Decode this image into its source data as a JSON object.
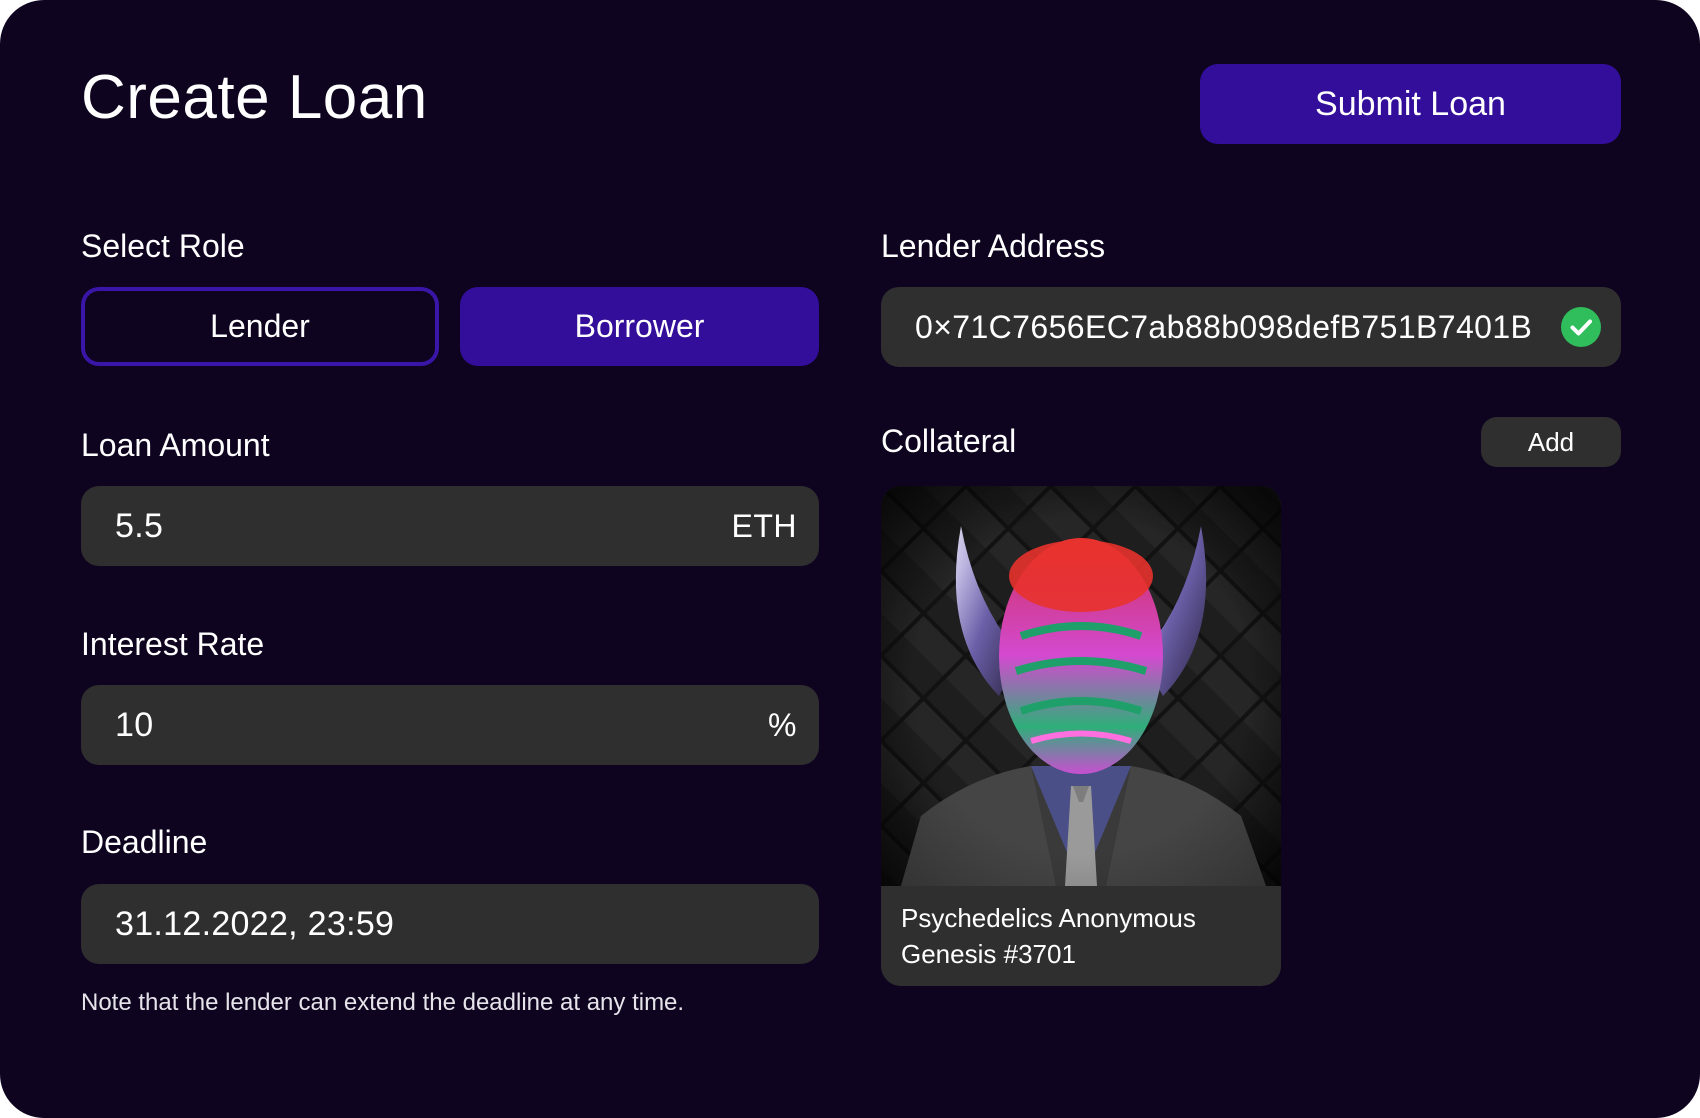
{
  "header": {
    "title": "Create Loan",
    "submit_label": "Submit Loan"
  },
  "role": {
    "label": "Select Role",
    "options": [
      "Lender",
      "Borrower"
    ],
    "selected": "Borrower"
  },
  "loan_amount": {
    "label": "Loan Amount",
    "value": "5.5",
    "unit": "ETH"
  },
  "interest_rate": {
    "label": "Interest Rate",
    "value": "10",
    "unit": "%"
  },
  "deadline": {
    "label": "Deadline",
    "value": "31.12.2022, 23:59",
    "note": "Note that the lender can extend the deadline at any time."
  },
  "lender_address": {
    "label": "Lender Address",
    "value": "0×71C7656EC7ab88b098defB751B7401B",
    "status_icon": "check-circle-icon"
  },
  "collateral": {
    "label": "Collateral",
    "add_label": "Add",
    "items": [
      {
        "name_line1": "Psychedelics Anonymous",
        "name_line2": "Genesis #3701"
      }
    ]
  },
  "colors": {
    "background": "#0f041f",
    "accent": "#320e9a",
    "accent_border": "#3a16a8",
    "field": "#2f2f2f",
    "success": "#2fbe5b"
  }
}
